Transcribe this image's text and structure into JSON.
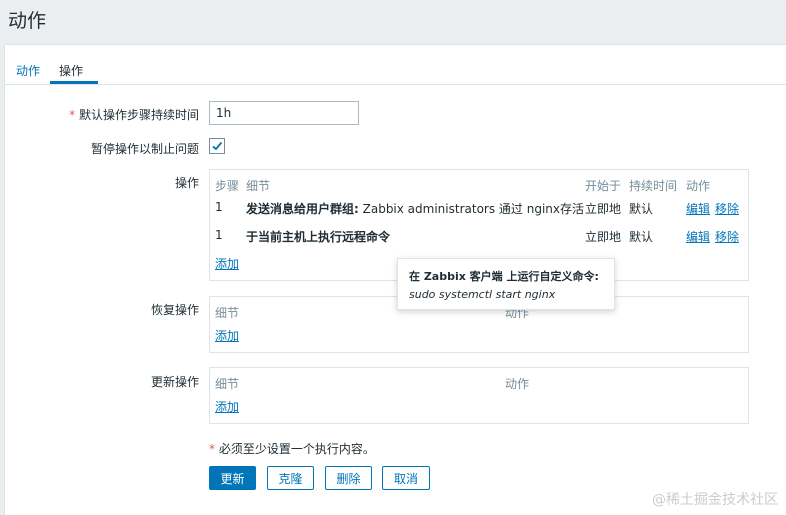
{
  "page": {
    "title": "动作"
  },
  "tabs": [
    {
      "label": "动作"
    },
    {
      "label": "操作"
    }
  ],
  "form": {
    "duration_label": "默认操作步骤持续时间",
    "required_mark": "*",
    "duration_value": "1h",
    "pause_label": "暂停操作以制止问题",
    "pause_checked": true
  },
  "operations": {
    "label": "操作",
    "headers": {
      "step": "步骤",
      "detail": "细节",
      "start": "开始于",
      "duration": "持续时间",
      "action": "动作"
    },
    "rows": [
      {
        "step": "1",
        "detail_bold": "发送消息给用户群组:",
        "detail_rest": " Zabbix administrators 通过 nginx存活",
        "start": "立即地",
        "duration": "默认",
        "edit": "编辑",
        "remove": "移除"
      },
      {
        "step": "1",
        "detail_bold": "于当前主机上执行远程命令",
        "detail_rest": "",
        "start": "立即地",
        "duration": "默认",
        "edit": "编辑",
        "remove": "移除"
      }
    ],
    "add": "添加"
  },
  "tooltip": {
    "title": "在 Zabbix 客户端 上运行自定义命令:",
    "command": "sudo systemctl start nginx"
  },
  "recovery": {
    "label": "恢复操作",
    "headers": {
      "detail": "细节",
      "action": "动作"
    },
    "add": "添加"
  },
  "update_ops": {
    "label": "更新操作",
    "headers": {
      "detail": "细节",
      "action": "动作"
    },
    "add": "添加"
  },
  "note": "必须至少设置一个执行内容。",
  "buttons": {
    "update": "更新",
    "clone": "克隆",
    "delete": "删除",
    "cancel": "取消"
  },
  "watermark": "@稀土掘金技术社区",
  "colors": {
    "accent": "#0275b8",
    "required": "#e45959",
    "header_text": "#768d99"
  }
}
